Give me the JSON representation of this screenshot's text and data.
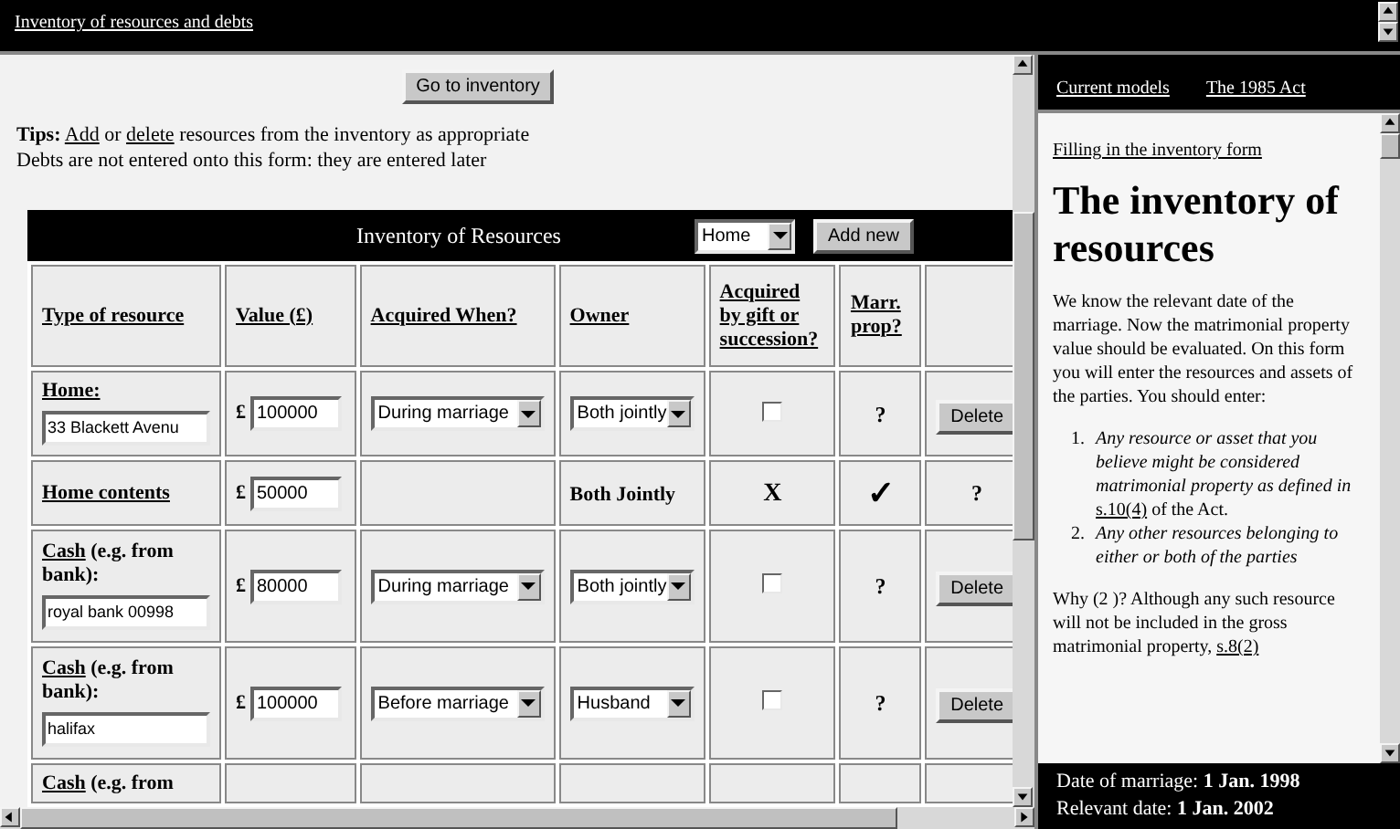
{
  "title_link": "Inventory of resources and debts",
  "goto_button": "Go to inventory",
  "tips": {
    "label": "Tips:",
    "add_link": "Add",
    "middle": "or",
    "delete_link": "delete",
    "rest": "resources from the inventory as appropriate",
    "line2": "Debts are not entered onto this form: they are entered later"
  },
  "table": {
    "title": "Inventory of Resources",
    "type_select": "Home",
    "add_button": "Add new",
    "columns": [
      "Type of resource",
      "Value (£)",
      "Acquired When?",
      "Owner",
      "Acquired by gift or succession?",
      "Marr. prop?"
    ],
    "rows": [
      {
        "kind": "editable",
        "type_link": "Home:",
        "type_input": "33 Blackett Avenu",
        "currency": "£",
        "value": "100000",
        "acquired": "During marriage",
        "owner": "Both jointly",
        "gift_checked": false,
        "marr": "?",
        "delete": "Delete"
      },
      {
        "kind": "fixed",
        "type_link": "Home contents",
        "currency": "£",
        "value": "50000",
        "owner": "Both Jointly",
        "gift": "X",
        "marr": "✓",
        "last": "?"
      },
      {
        "kind": "editable",
        "type_link": "Cash",
        "type_rest": " (e.g. from bank):",
        "type_input": "royal bank 00998",
        "currency": "£",
        "value": "80000",
        "acquired": "During marriage",
        "owner": "Both jointly",
        "gift_checked": false,
        "marr": "?",
        "delete": "Delete"
      },
      {
        "kind": "editable",
        "type_link": "Cash",
        "type_rest": " (e.g. from bank):",
        "type_input": "halifax",
        "currency": "£",
        "value": "100000",
        "acquired": "Before marriage",
        "owner": "Husband",
        "gift_checked": false,
        "marr": "?",
        "delete": "Delete"
      },
      {
        "kind": "partial",
        "type_link": "Cash",
        "type_rest": " (e.g. from"
      }
    ]
  },
  "side": {
    "links": [
      "Current models",
      "The 1985 Act"
    ],
    "crumb": "Filling in the inventory form",
    "heading": "The inventory of resources",
    "intro": "We know the relevant date of the marriage. Now the matrimonial property value should be evaluated. On this form you will enter the resources and assets of the parties. You should enter:",
    "list": [
      {
        "number": "1.",
        "text": "Any resource or asset that you believe might be considered matrimonial property as defined in",
        "link": "s.10(4)",
        "after": "of the Act."
      },
      {
        "number": "2.",
        "text": "Any other resources belonging to either or both of the parties"
      }
    ],
    "why": "Why (2 )? Although any such resource will not be included in the gross matrimonial property,",
    "why_link": "s.8(2)",
    "footer": [
      {
        "label": "Date of marriage:",
        "value": "1 Jan. 1998"
      },
      {
        "label": "Relevant date:",
        "value": "1 Jan. 2002"
      }
    ]
  }
}
